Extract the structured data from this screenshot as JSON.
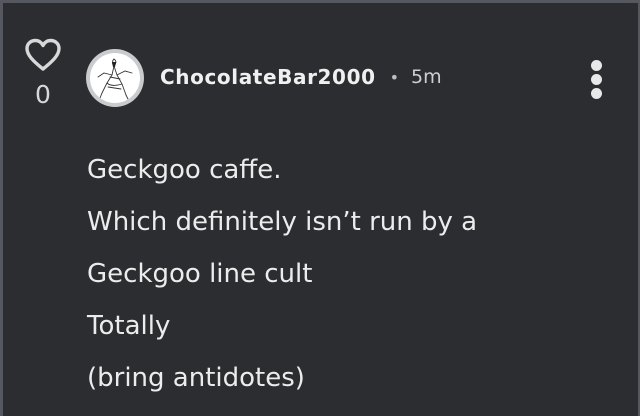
{
  "post": {
    "like_count": "0",
    "username": "ChocolateBar2000",
    "separator": "•",
    "time": "5m",
    "lines": [
      "Geckgoo caffe.",
      "Which definitely isn’t run by a",
      "Geckgoo line cult",
      "Totally",
      "(bring antidotes)"
    ]
  },
  "icons": {
    "like": "heart-outline-icon",
    "more": "vertical-ellipsis-icon"
  },
  "colors": {
    "background": "#2b2d31",
    "text": "#ececec",
    "border": "#55585e"
  }
}
